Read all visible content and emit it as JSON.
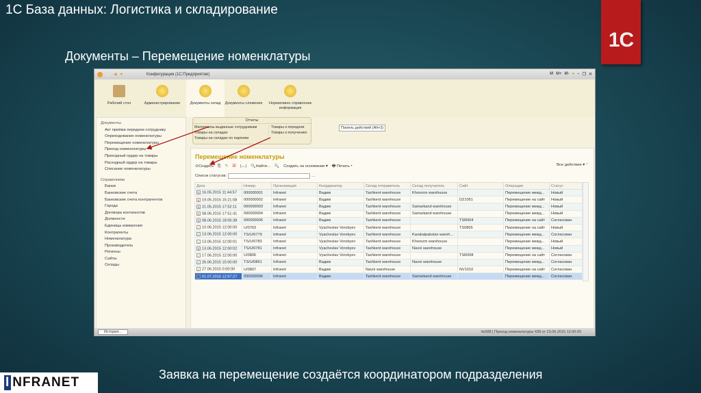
{
  "slide": {
    "title": "1С База данных: Логистика и складирование",
    "subtitle": "Документы – Перемещение номенклатуры",
    "caption": "Заявка на перемещение создаётся координатором подразделения",
    "logo_1c": "1С",
    "logo_infranet": "INFRANET"
  },
  "window": {
    "title": "Конфигурация (1С:Предприятие)",
    "tools": [
      "M",
      "M+",
      "M-"
    ]
  },
  "sections": [
    {
      "label": "Рабочий стол"
    },
    {
      "label": "Администрирование"
    },
    {
      "label": "Документы склад"
    },
    {
      "label": "Документы слежения"
    },
    {
      "label": "Нормативно справочник информация"
    }
  ],
  "sidebar": {
    "docs_header": "Документы",
    "docs": [
      "Акт приёма передачи сотруднику",
      "Оприходование номенклатуры",
      "Перемещение номенклатуры",
      "Приход номенклатуры",
      "Приходный ордер на товары",
      "Расходный ордер на товары",
      "Списание номенклатуры"
    ],
    "refs_header": "Справочники",
    "refs": [
      "Банки",
      "Банковские счета",
      "Банковские счета контрагентов",
      "Города",
      "Договора контагентов",
      "Должности",
      "Единицы измерения",
      "Контрагенты",
      "Номенклатура",
      "Производитель",
      "Регионы",
      "Сайты",
      "Склады"
    ]
  },
  "reports": {
    "header": "Отчеты",
    "col1": [
      "Материалы выданные сотрудникам",
      "Товары на складах",
      "Товары на складах по партиям"
    ],
    "col2": [
      "Товары к передачи",
      "Товары к получению"
    ]
  },
  "action_panel": "Панель действий (Alt+3)",
  "content": {
    "title": "Перемещение номенклатуры",
    "toolbar": {
      "create": "Создать",
      "find": "Найти...",
      "create_based": "Создать на основании ▾",
      "print": "Печать ▾",
      "all_actions": "Все действия ▾"
    },
    "status_list_label": "Список статусов:",
    "status_list_value": ""
  },
  "table": {
    "columns": [
      "Дата",
      "Номер",
      "Организация",
      "Координатор",
      "Склад отправитель",
      "Склад получатель",
      "Сайт",
      "Операция",
      "Статус"
    ],
    "rows": [
      {
        "mark": "x",
        "c": [
          "16.05.2015 11:44:57",
          "000000001",
          "Infranet",
          "Вадим",
          "Tashkent warehouse",
          "Khorezm warehouse",
          "",
          "Перемещение межд...",
          "Новый"
        ]
      },
      {
        "mark": "x",
        "c": [
          "19.05.2015 15:21:08",
          "000000002",
          "Infranet",
          "Вадим",
          "Tashkent warehouse",
          "",
          "DZ1051",
          "Перемещение на сайт",
          "Новый"
        ]
      },
      {
        "mark": "x",
        "c": [
          "21.05.2015 17:52:11",
          "000000003",
          "Infranet",
          "Вадим",
          "Tashkent warehouse",
          "Samarkand warehouse",
          "",
          "Перемещение межд...",
          "Новый"
        ]
      },
      {
        "mark": "x",
        "c": [
          "08.06.2015 17:51:41",
          "000000004",
          "Infranet",
          "Вадим",
          "Tashkent warehouse",
          "Samarkand warehouse",
          "",
          "Перемещение межд...",
          "Новый"
        ]
      },
      {
        "mark": "x",
        "c": [
          "08.06.2015 18:05:38",
          "000000005",
          "Infranet",
          "Вадим",
          "Tashkent warehouse",
          "",
          "TSR004",
          "Перемещение на сайт",
          "Согласован"
        ]
      },
      {
        "mark": "ok",
        "c": [
          "10.06.2015 12:00:00",
          "U/0763",
          "Infranet",
          "Vyacheslav Vorobyev",
          "Tashkent warehouse",
          "",
          "TS0865",
          "Перемещение на сайт",
          "Новый"
        ]
      },
      {
        "mark": "ok",
        "c": [
          "13.06.2015 12:00:00",
          "TS/U/0779",
          "Infranet",
          "Vyacheslav Vorobyev",
          "Tashkent warehouse",
          "Karakalpakstan wareh...",
          "",
          "Перемещение межд...",
          "Согласован"
        ]
      },
      {
        "mark": "ok",
        "c": [
          "13.06.2015 12:00:01",
          "TS/U/0783",
          "Infranet",
          "Vyacheslav Vorobyev",
          "Tashkent warehouse",
          "Khorezm warehouse",
          "",
          "Перемещение межд...",
          "Новый"
        ]
      },
      {
        "mark": "x",
        "c": [
          "13.06.2015 12:00:02",
          "TS/U/0781",
          "Infranet",
          "Vyacheslav Vorobyev",
          "Tashkent warehouse",
          "Navoi warehouse",
          "",
          "Перемещение межд...",
          "Новый"
        ]
      },
      {
        "mark": "ok",
        "c": [
          "17.06.2015 12:00:00",
          "U/0806",
          "Infranet",
          "Vyacheslav Vorobyev",
          "Tashkent warehouse",
          "",
          "TSR008",
          "Перемещение на сайт",
          "Согласован"
        ]
      },
      {
        "mark": "ok",
        "c": [
          "26.06.2015 15:00:00",
          "TS/U/0861",
          "Infranet",
          "Вадим",
          "Tashkent warehouse",
          "Navoi warehouse",
          "",
          "Перемещение межд...",
          "Согласован"
        ]
      },
      {
        "mark": "ok",
        "c": [
          "27.06.2015 0:00:00",
          "U/0807",
          "Infranet",
          "Вадим",
          "Navoi warehouse",
          "",
          "NV1010",
          "Перемещение на сайт",
          "Согласован"
        ]
      },
      {
        "mark": "ok",
        "sel": true,
        "c": [
          "01.07.2015 12:57:27",
          "000000006",
          "Infranet",
          "Вадим",
          "Tashkent warehouse",
          "Samarkand warehouse",
          "",
          "Перемещение межд...",
          "Согласован"
        ]
      }
    ]
  },
  "statusbar": {
    "history": "История...",
    "num": "№588",
    "info": "Приход номенклатуры 438 от 23.06.2015 12:00:00"
  }
}
